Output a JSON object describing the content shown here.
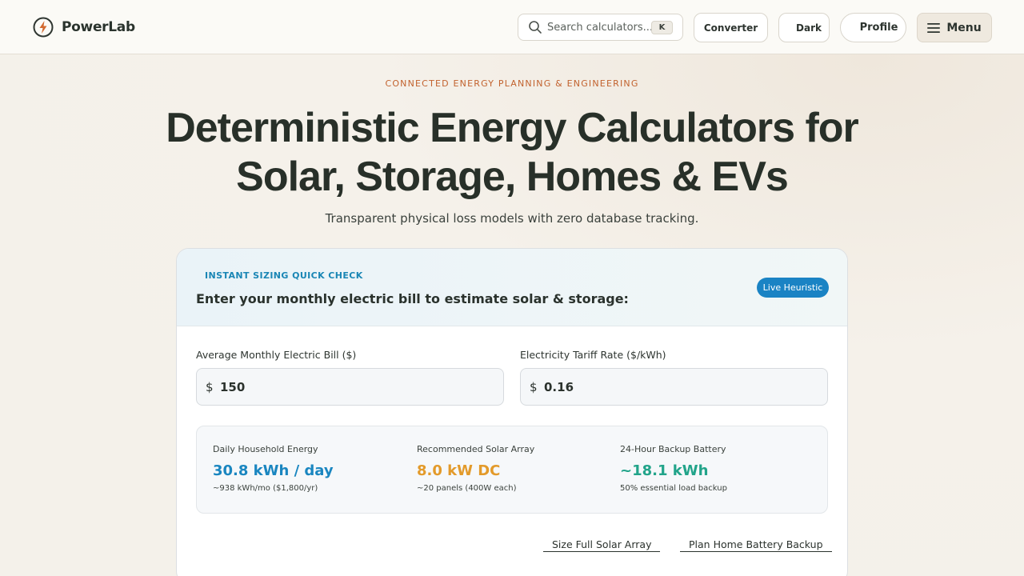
{
  "header": {
    "brand": "PowerLab",
    "search_placeholder": "Search calculators...",
    "search_shortcut": "K",
    "converter_label": "Converter",
    "dark_label": "Dark",
    "profile_label": "Profile",
    "menu_label": "Menu"
  },
  "hero": {
    "eyebrow": "CONNECTED ENERGY PLANNING & ENGINEERING",
    "title": "Deterministic Energy Calculators for Solar, Storage, Homes & EVs",
    "subtitle": "Transparent physical loss models with zero database tracking."
  },
  "quick_check": {
    "eyebrow": "INSTANT SIZING QUICK CHECK",
    "title": "Enter your monthly electric bill to estimate solar & storage:",
    "badge": "Live Heuristic",
    "bill_label": "Average Monthly Electric Bill ($)",
    "bill_prefix": "$",
    "bill_value": "150",
    "tariff_label": "Electricity Tariff Rate ($/kWh)",
    "tariff_prefix": "$",
    "tariff_value": "0.16",
    "results": [
      {
        "label": "Daily Household Energy",
        "value": "30.8 kWh / day",
        "note": "~938 kWh/mo ($1,800/yr)",
        "color": "#1a86c0"
      },
      {
        "label": "Recommended Solar Array",
        "value": "8.0 kW DC",
        "note": "~20 panels (400W each)",
        "color": "#e39a2a"
      },
      {
        "label": "24-Hour Backup Battery",
        "value": "~18.1 kWh",
        "note": "50% essential load backup",
        "color": "#22a48a"
      }
    ],
    "link_solar": "Size Full Solar Array",
    "link_battery": "Plan Home Battery Backup"
  },
  "colors": {
    "accent_orange": "#c2622e",
    "accent_blue": "#1a83c4"
  }
}
